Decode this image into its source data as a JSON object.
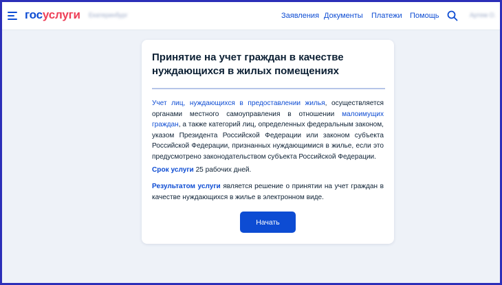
{
  "header": {
    "logo_part1": "гос",
    "logo_part2": "услуги",
    "city": "Екатеринбург",
    "nav": [
      "Заявления",
      "Документы",
      "Платежи",
      "Помощь"
    ],
    "user": "Артем О."
  },
  "card": {
    "title": "Принятие на учет граждан в качестве нуждающихся в жилых помещениях",
    "p1": {
      "link1": "Учет лиц, нуждающихся в предоставлении жилья",
      "text1": ", осуществляется органами местного самоуправления в отношении ",
      "link2": "малоимущих граждан",
      "text2": ", а также категорий лиц, определенных федеральным законом, указом Президента Российской Федерации или законом субъекта Российской Федерации, признанных нуждающимися в жилье, если это предусмотрено законодательством субъекта Российской Федерации."
    },
    "p2": {
      "label": "Срок услуги",
      "text": " 25 рабочих дней."
    },
    "p3": {
      "label": "Результатом услуги",
      "text": " является решение о принятии на учет граждан в качестве нуждающихся в жилье в электронном виде."
    },
    "button_label": "Начать"
  },
  "colors": {
    "frame": "#2c2fb8",
    "brand_blue": "#0d4cd3",
    "brand_red": "#ee3f58",
    "background": "#eef2f8",
    "text": "#0b1f33"
  }
}
